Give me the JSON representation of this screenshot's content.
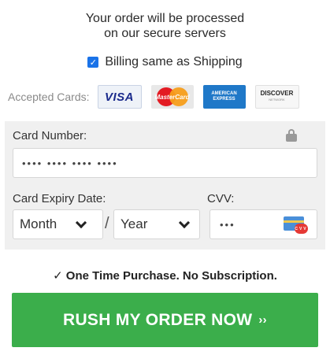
{
  "secure": {
    "line1": "Your order will be processed",
    "line2": "on our secure servers"
  },
  "billing": {
    "label": "Billing same as Shipping",
    "checked": true
  },
  "cards": {
    "label": "Accepted Cards:",
    "visa": "VISA",
    "mastercard": "MasterCard",
    "amex_line1": "AMERICAN",
    "amex_line2": "EXPRESS",
    "discover": "DISCOVER",
    "discover_sub": "NETWORK"
  },
  "form": {
    "card_number_label": "Card Number:",
    "card_number_value": "•••• •••• •••• ••••",
    "expiry_label": "Card Expiry Date:",
    "month_value": "Month",
    "separator": "/",
    "year_value": "Year",
    "cvv_label": "CVV:",
    "cvv_value": "•••",
    "cvv_badge": "CVV"
  },
  "purchase_note": "✓ One Time Purchase. No Subscription.",
  "rush_button": {
    "label": "RUSH MY ORDER NOW",
    "arrows": "››"
  },
  "colors": {
    "button_green": "#3bae4b",
    "checkbox_blue": "#1a73e8",
    "form_bg": "#f0f0f0"
  }
}
